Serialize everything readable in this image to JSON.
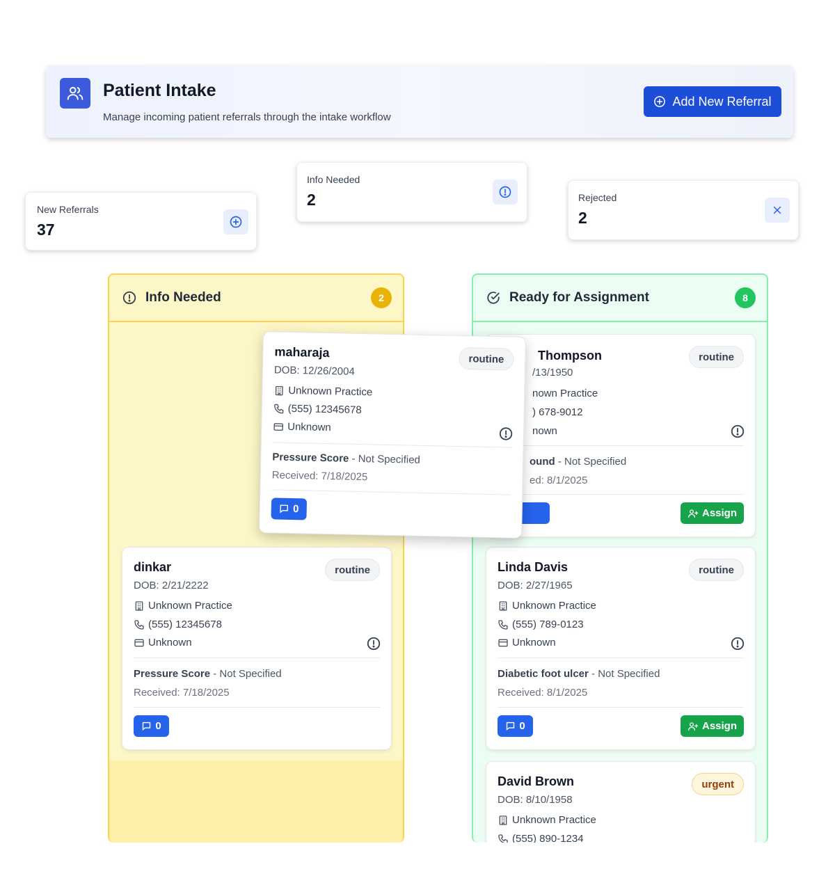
{
  "header": {
    "title": "Patient Intake",
    "subtitle": "Manage incoming patient referrals through the intake workflow",
    "add_button_label": "Add New Referral"
  },
  "stats": [
    {
      "label": "New Referrals",
      "value": "37",
      "icon": "plus-circle-icon"
    },
    {
      "label": "Info Needed",
      "value": "2",
      "icon": "alert-circle-icon"
    },
    {
      "label": "Rejected",
      "value": "2",
      "icon": "x-icon"
    }
  ],
  "columns": {
    "info_needed": {
      "title": "Info Needed",
      "count": "2",
      "color": "#eab308",
      "cards": [
        {
          "name": "maharaja",
          "dob": "DOB: 12/26/2004",
          "priority": "routine",
          "practice": "Unknown Practice",
          "phone": "(555) 12345678",
          "insurance": "Unknown",
          "condition": "Pressure Score",
          "condition_detail": " - Not Specified",
          "received": "Received: 7/18/2025",
          "messages": "0"
        },
        {
          "name": "dinkar",
          "dob": "DOB: 2/21/2222",
          "priority": "routine",
          "practice": "Unknown Practice",
          "phone": "(555) 12345678",
          "insurance": "Unknown",
          "condition": "Pressure Score",
          "condition_detail": " - Not Specified",
          "received": "Received: 7/18/2025",
          "messages": "0"
        }
      ]
    },
    "ready": {
      "title": "Ready for Assignment",
      "count": "8",
      "color": "#22c55e",
      "assign_label": "Assign",
      "cards": [
        {
          "name": "Thompson",
          "dob": "/13/1950",
          "priority": "routine",
          "practice": "nown Practice",
          "phone": ") 678-9012",
          "insurance": "nown",
          "condition": "ound",
          "condition_detail": " - Not Specified",
          "received": "ed: 8/1/2025"
        },
        {
          "name": "Linda Davis",
          "dob": "DOB: 2/27/1965",
          "priority": "routine",
          "practice": "Unknown Practice",
          "phone": "(555) 789-0123",
          "insurance": "Unknown",
          "condition": "Diabetic foot ulcer",
          "condition_detail": " - Not Specified",
          "received": "Received: 8/1/2025",
          "messages": "0"
        },
        {
          "name": "David Brown",
          "dob": "DOB: 8/10/1958",
          "priority": "urgent",
          "practice": "Unknown Practice",
          "phone": "(555) 890-1234"
        }
      ]
    }
  },
  "colors": {
    "primary": "#1d4ed8",
    "assign_green": "#16a34a",
    "info_needed_bg": "#fdf7c7",
    "ready_bg": "#ecfdf3"
  }
}
